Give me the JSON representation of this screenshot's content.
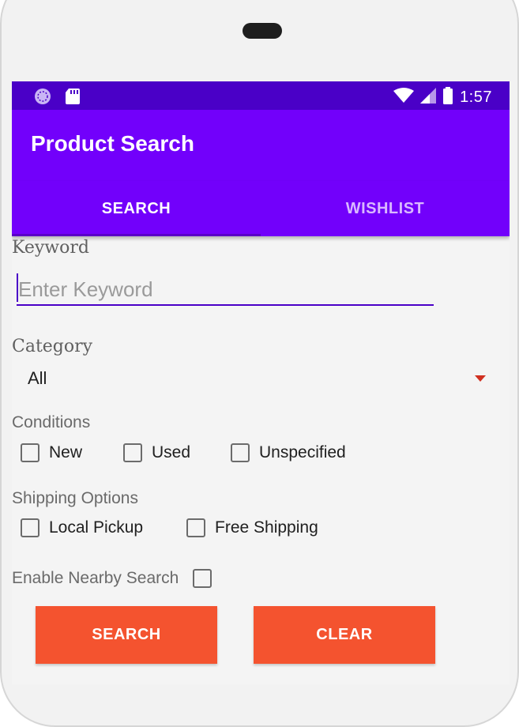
{
  "status_bar": {
    "time": "1:57",
    "left_icons": [
      "sync-icon",
      "sd-card-icon"
    ],
    "right_icons": [
      "wifi-icon",
      "signal-icon",
      "battery-icon"
    ]
  },
  "app_bar": {
    "title": "Product Search"
  },
  "tabs": [
    {
      "label": "SEARCH",
      "selected": true
    },
    {
      "label": "WISHLIST",
      "selected": false
    }
  ],
  "form": {
    "keyword_label": "Keyword",
    "keyword_placeholder": "Enter Keyword",
    "keyword_value": "",
    "category_label": "Category",
    "category_value": "All",
    "conditions_label": "Conditions",
    "conditions": [
      {
        "label": "New",
        "checked": false
      },
      {
        "label": "Used",
        "checked": false
      },
      {
        "label": "Unspecified",
        "checked": false
      }
    ],
    "shipping_label": "Shipping Options",
    "shipping": [
      {
        "label": "Local Pickup",
        "checked": false
      },
      {
        "label": "Free Shipping",
        "checked": false
      }
    ],
    "nearby_label": "Enable Nearby Search",
    "nearby_checked": false
  },
  "buttons": {
    "search": "SEARCH",
    "clear": "CLEAR"
  },
  "colors": {
    "status_bar": "#4a00c7",
    "app_bar": "#7200fb",
    "accent": "#f4532f",
    "input_underline": "#4a00c7"
  }
}
